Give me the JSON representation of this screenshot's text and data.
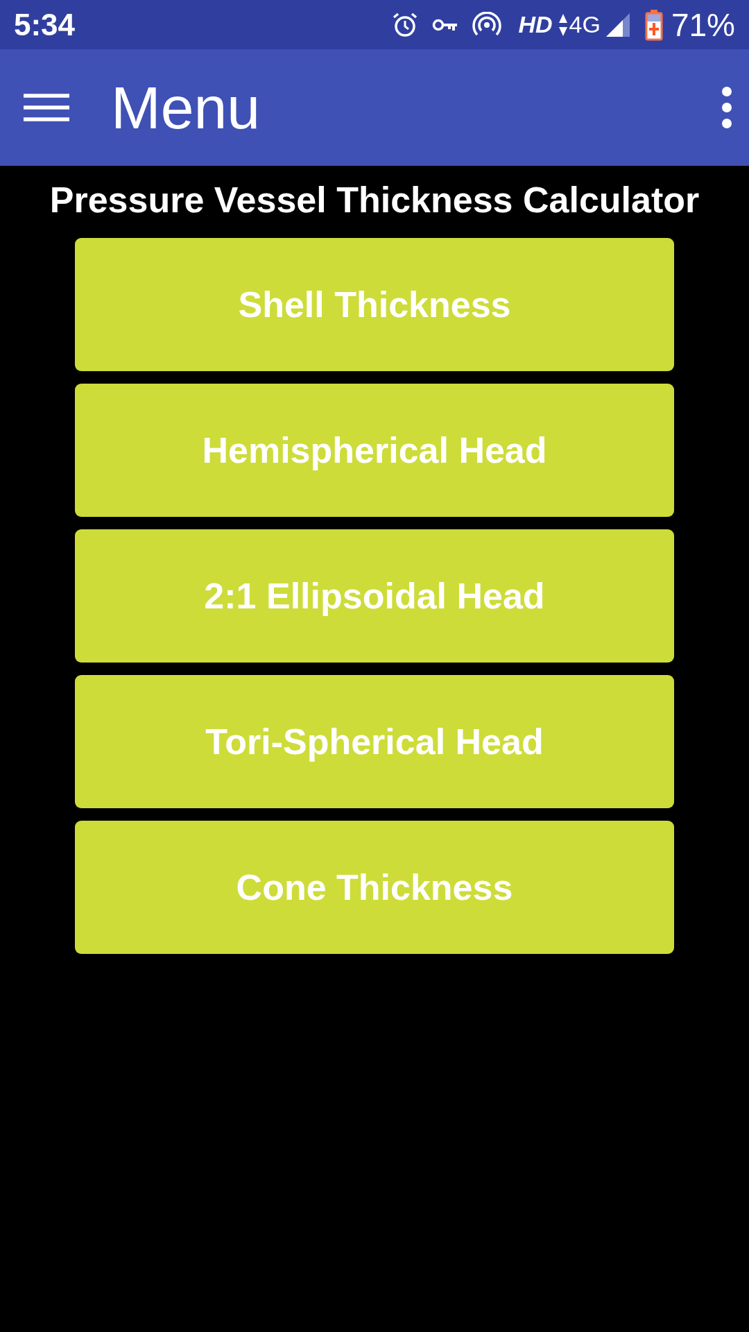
{
  "status_bar": {
    "time": "5:34",
    "network_quality": "HD",
    "network_type": "4G",
    "battery_percent": "71%"
  },
  "app_bar": {
    "title": "Menu"
  },
  "page": {
    "heading": "Pressure Vessel Thickness Calculator"
  },
  "menu_buttons": [
    {
      "label": "Shell Thickness"
    },
    {
      "label": "Hemispherical Head"
    },
    {
      "label": "2:1 Ellipsoidal Head"
    },
    {
      "label": "Tori-Spherical Head"
    },
    {
      "label": "Cone Thickness"
    }
  ]
}
